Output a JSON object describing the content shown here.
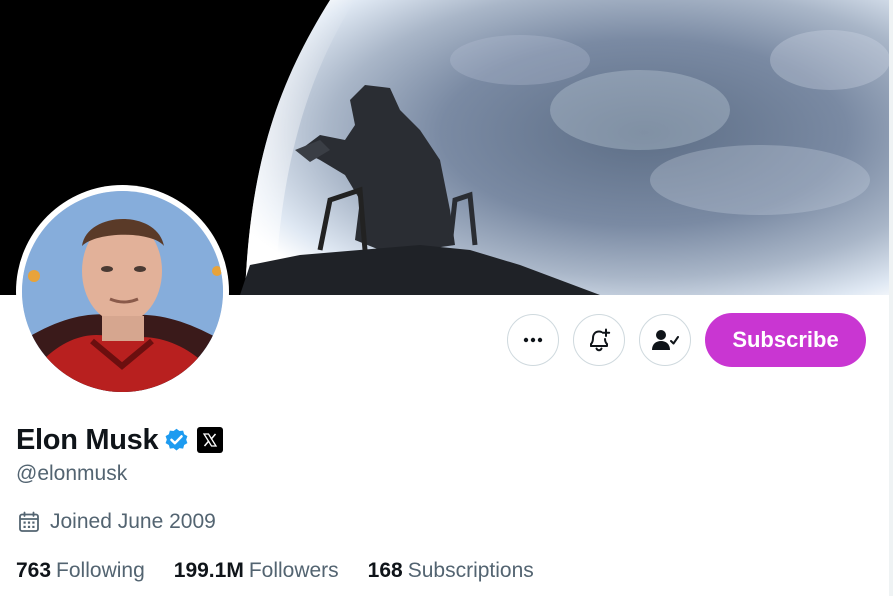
{
  "profile": {
    "name": "Elon Musk",
    "handle": "@elonmusk",
    "joined": "Joined June 2009",
    "verified_color": "#1d9bf0"
  },
  "actions": {
    "more_icon": "more-icon",
    "notify_icon": "bell-plus-icon",
    "follow_icon": "person-check-icon",
    "subscribe_label": "Subscribe",
    "subscribe_color": "#c936d2"
  },
  "stats": [
    {
      "count": "763",
      "label": "Following"
    },
    {
      "count": "199.1M",
      "label": "Followers"
    },
    {
      "count": "168",
      "label": "Subscriptions"
    }
  ]
}
